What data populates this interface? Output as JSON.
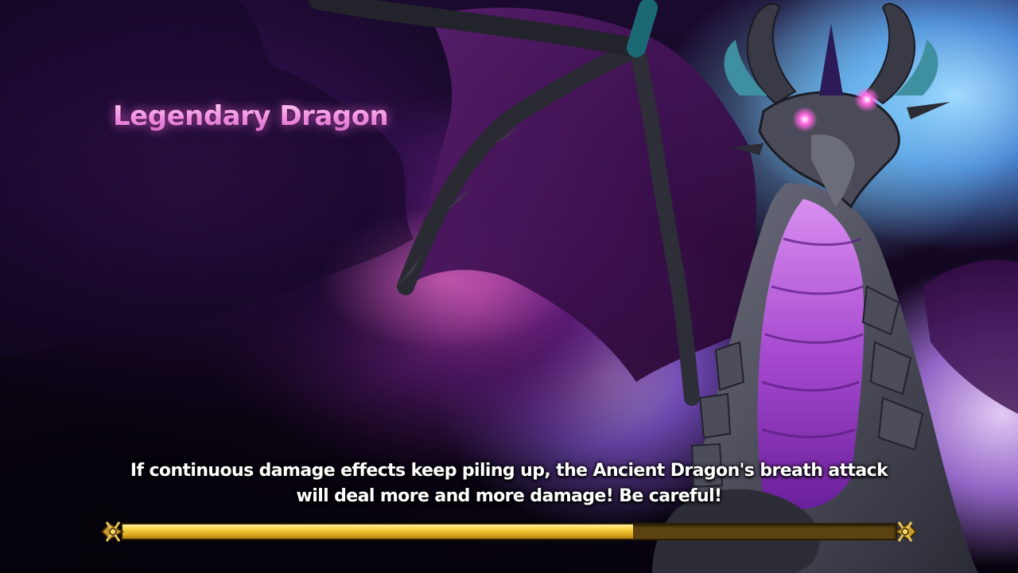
{
  "loading_screen": {
    "title": "Legendary Dragon",
    "tip_line_1": "If continuous damage effects keep piling up, the Ancient Dragon's breath attack",
    "tip_line_2": "will deal more and more damage! Be careful!",
    "progress_fraction": 0.66
  },
  "colors": {
    "title_pink": "#f08ee0",
    "progress_gold": "#f7cf3e",
    "progress_track": "#5a4310",
    "tip_text": "#ffffff"
  },
  "icons": {
    "progress_end_caps": "crossed-ornament-icon"
  }
}
